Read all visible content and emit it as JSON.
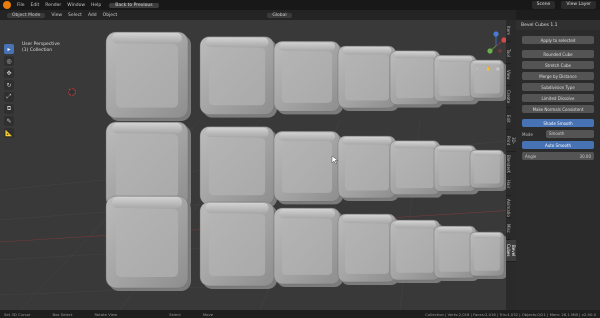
{
  "topbar": {
    "menus": [
      "File",
      "Edit",
      "Render",
      "Window",
      "Help"
    ],
    "back_button": "Back to Previous",
    "scene_label": "Scene",
    "view_layer_label": "View Layer"
  },
  "header2": {
    "mode": "Object Mode",
    "menus": [
      "View",
      "Select",
      "Add",
      "Object"
    ],
    "transform": "Global"
  },
  "viewport": {
    "perspective": "User Perspective",
    "collection": "(1) Collection"
  },
  "sidebar_tabs": [
    "Item",
    "Tool",
    "View",
    "Create",
    "Edit",
    "3D-Print",
    "BlenderKit",
    "Hair",
    "Animation",
    "Misc",
    "Bevel Cubes"
  ],
  "panel": {
    "title": "Bevel Cubes 1.1",
    "apply_label": "Apply to selected",
    "buttons": [
      "Rounded Cube",
      "Stretch Cube",
      "Merge by Distance",
      "Subdivision Type",
      "Limited Dissolve",
      "Make Normals Consistent"
    ],
    "smooth_button": "Shade Smooth",
    "mode_label": "Mode",
    "mode_value": "Smooth",
    "auto_smooth": "Auto Smooth",
    "angle_label": "Angle",
    "angle_value": "30.00"
  },
  "status": {
    "items": [
      "Set 3D Cursor",
      "Box Select",
      "Rotate View",
      "Select",
      "Move"
    ],
    "info": "Collection | Verts:2,016 | Faces:2,016 | Tris:4,032 | Objects:0/21 | Mem: 26.1 MiB | v2.90.0"
  },
  "cube_rows": 3,
  "cube_cols": 7
}
